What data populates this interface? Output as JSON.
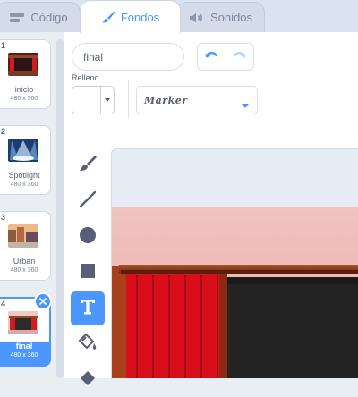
{
  "tabs": [
    {
      "label": "Código",
      "icon": "code-icon",
      "active": false
    },
    {
      "label": "Fondos",
      "icon": "paintbrush-icon",
      "active": true
    },
    {
      "label": "Sonidos",
      "icon": "speaker-icon",
      "active": false
    }
  ],
  "costumes": [
    {
      "number": "1",
      "name": "inicio",
      "size": "480 x 360",
      "selected": false
    },
    {
      "number": "2",
      "name": "Spotlight",
      "size": "480 x 360",
      "selected": false
    },
    {
      "number": "3",
      "name": "Urban",
      "size": "480 x 360",
      "selected": false
    },
    {
      "number": "4",
      "name": "final",
      "size": "480 x 360",
      "selected": true
    }
  ],
  "editor": {
    "costume_name": "final",
    "fill_label": "Relleno",
    "fill_color": "#ffffff",
    "font": "Marker"
  },
  "tools": [
    {
      "name": "brush-icon",
      "active": false
    },
    {
      "name": "line-icon",
      "active": false
    },
    {
      "name": "circle-icon",
      "active": false
    },
    {
      "name": "rectangle-icon",
      "active": false
    },
    {
      "name": "text-icon",
      "active": true
    },
    {
      "name": "fill-icon",
      "active": false
    },
    {
      "name": "eraser-icon",
      "active": false
    }
  ],
  "colors": {
    "accent": "#4c97ff",
    "tab_bar": "#d9e3f2",
    "selector_bg": "#e9eef2"
  }
}
